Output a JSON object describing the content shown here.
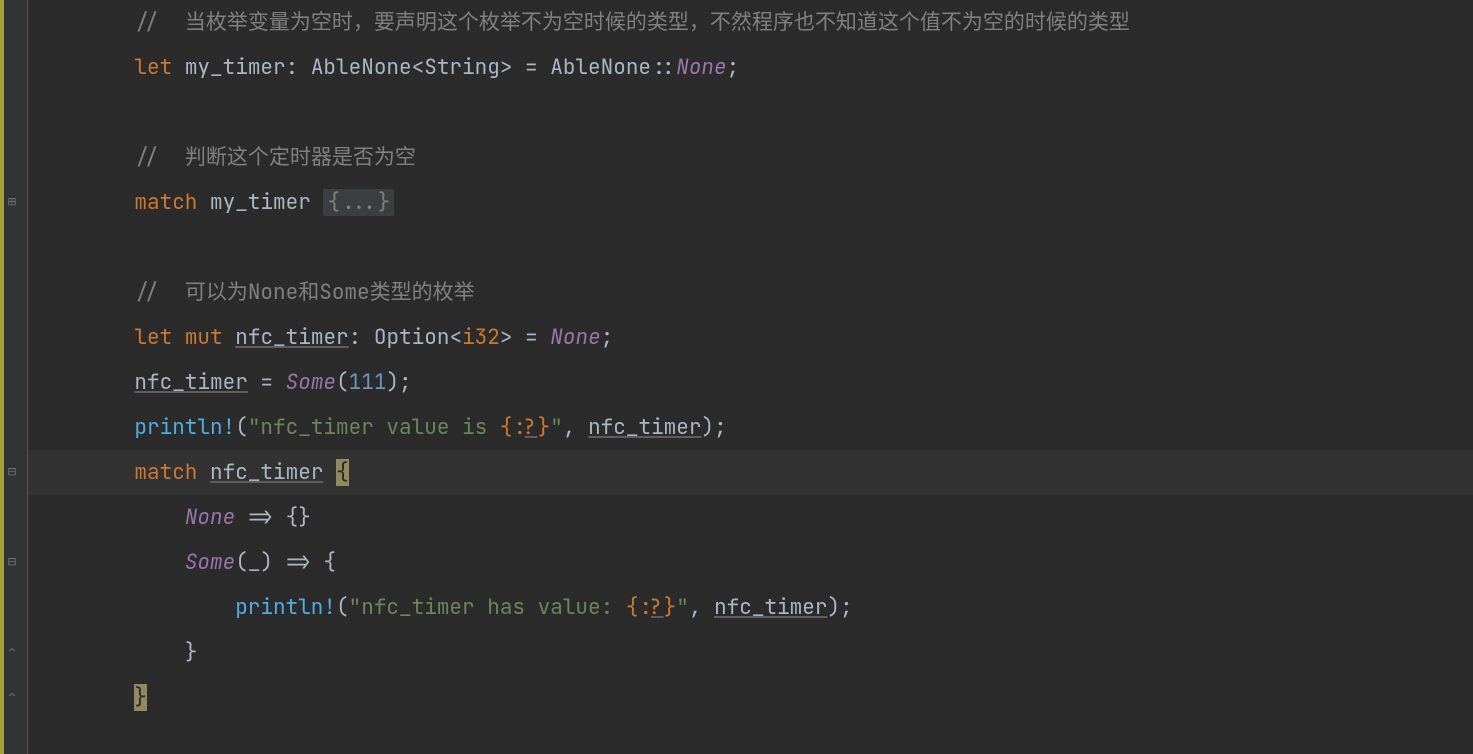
{
  "code": {
    "lines": [
      {
        "indent": "    ",
        "tokens": [
          {
            "text": "// ",
            "class": "comment"
          },
          {
            "text": " 当枚举变量为空时，要声明这个枚举不为空时候的类型，不然程序也不知道这个值不为空的时候的类型",
            "class": "comment"
          }
        ]
      },
      {
        "indent": "    ",
        "tokens": [
          {
            "text": "let",
            "class": "keyword"
          },
          {
            "text": " my_timer: AbleNone<",
            "class": "type"
          },
          {
            "text": "String",
            "class": "type"
          },
          {
            "text": "> = AbleNone::",
            "class": "type"
          },
          {
            "text": "None",
            "class": "italic"
          },
          {
            "text": ";",
            "class": "punct"
          }
        ]
      },
      {
        "indent": "",
        "tokens": []
      },
      {
        "indent": "    ",
        "tokens": [
          {
            "text": "// ",
            "class": "comment"
          },
          {
            "text": " 判断这个定时器是否为空",
            "class": "comment"
          }
        ]
      },
      {
        "indent": "    ",
        "tokens": [
          {
            "text": "match",
            "class": "keyword"
          },
          {
            "text": " my_timer ",
            "class": "type"
          },
          {
            "text": "{...}",
            "class": "fold-box"
          }
        ]
      },
      {
        "indent": "",
        "tokens": []
      },
      {
        "indent": "    ",
        "tokens": [
          {
            "text": "// ",
            "class": "comment"
          },
          {
            "text": " 可以为None和Some类型的枚举",
            "class": "comment"
          }
        ]
      },
      {
        "indent": "    ",
        "tokens": [
          {
            "text": "let",
            "class": "keyword"
          },
          {
            "text": " ",
            "class": "type"
          },
          {
            "text": "mut",
            "class": "mut-kw"
          },
          {
            "text": " ",
            "class": "type"
          },
          {
            "text": "nfc_timer",
            "class": "underline"
          },
          {
            "text": ": Option<",
            "class": "type"
          },
          {
            "text": "i32",
            "class": "keyword"
          },
          {
            "text": "> = ",
            "class": "type"
          },
          {
            "text": "None",
            "class": "italic"
          },
          {
            "text": ";",
            "class": "punct"
          }
        ]
      },
      {
        "indent": "    ",
        "tokens": [
          {
            "text": "nfc_timer",
            "class": "underline"
          },
          {
            "text": " = ",
            "class": "type"
          },
          {
            "text": "Some",
            "class": "italic"
          },
          {
            "text": "(",
            "class": "punct"
          },
          {
            "text": "111",
            "class": "number"
          },
          {
            "text": ");",
            "class": "punct"
          }
        ]
      },
      {
        "indent": "    ",
        "tokens": [
          {
            "text": "println!",
            "class": "macro"
          },
          {
            "text": "(",
            "class": "punct"
          },
          {
            "text": "\"nfc_timer value is ",
            "class": "string"
          },
          {
            "text": "{:",
            "class": "format-spec"
          },
          {
            "text": "?",
            "class": "format-spec underline"
          },
          {
            "text": "}",
            "class": "format-spec"
          },
          {
            "text": "\"",
            "class": "string"
          },
          {
            "text": ", ",
            "class": "punct"
          },
          {
            "text": "nfc_timer",
            "class": "underline"
          },
          {
            "text": ");",
            "class": "punct"
          }
        ]
      },
      {
        "indent": "    ",
        "highlighted": true,
        "tokens": [
          {
            "text": "match",
            "class": "keyword"
          },
          {
            "text": " ",
            "class": "type"
          },
          {
            "text": "nfc_timer",
            "class": "underline"
          },
          {
            "text": " ",
            "class": "type"
          },
          {
            "text": "{",
            "class": "cursor-brace"
          }
        ]
      },
      {
        "indent": "        ",
        "tokens": [
          {
            "text": "None",
            "class": "italic"
          },
          {
            "text": " => {}",
            "class": "type"
          }
        ]
      },
      {
        "indent": "        ",
        "tokens": [
          {
            "text": "Some",
            "class": "italic"
          },
          {
            "text": "(_) => {",
            "class": "type"
          }
        ]
      },
      {
        "indent": "            ",
        "tokens": [
          {
            "text": "println!",
            "class": "macro"
          },
          {
            "text": "(",
            "class": "punct"
          },
          {
            "text": "\"nfc_timer has value: ",
            "class": "string"
          },
          {
            "text": "{:",
            "class": "format-spec"
          },
          {
            "text": "?",
            "class": "format-spec underline"
          },
          {
            "text": "}",
            "class": "format-spec"
          },
          {
            "text": "\"",
            "class": "string"
          },
          {
            "text": ", ",
            "class": "punct"
          },
          {
            "text": "nfc_timer",
            "class": "underline"
          },
          {
            "text": ");",
            "class": "punct"
          }
        ]
      },
      {
        "indent": "        ",
        "tokens": [
          {
            "text": "}",
            "class": "type"
          }
        ]
      },
      {
        "indent": "    ",
        "tokens": [
          {
            "text": "}",
            "class": "cursor-brace"
          }
        ]
      }
    ]
  },
  "gutterIcons": [
    {
      "type": "expand",
      "line": 4,
      "symbol": "⊞"
    },
    {
      "type": "collapse",
      "line": 10,
      "symbol": "⊟"
    },
    {
      "type": "collapse",
      "line": 12,
      "symbol": "⊟"
    },
    {
      "type": "collapse-end",
      "line": 14,
      "symbol": "⌃"
    },
    {
      "type": "collapse-end",
      "line": 15,
      "symbol": "⌃"
    }
  ]
}
